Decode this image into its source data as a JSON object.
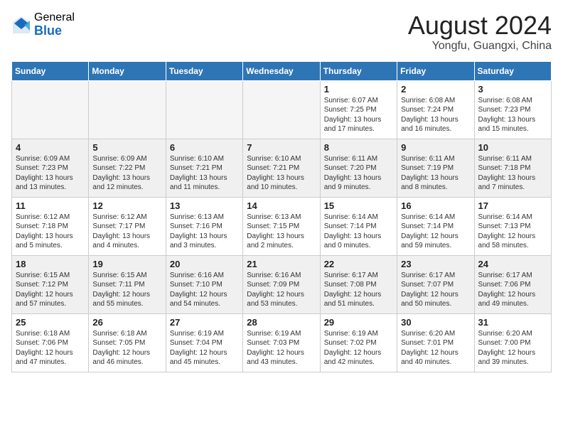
{
  "header": {
    "logo_general": "General",
    "logo_blue": "Blue",
    "month_year": "August 2024",
    "location": "Yongfu, Guangxi, China"
  },
  "weekdays": [
    "Sunday",
    "Monday",
    "Tuesday",
    "Wednesday",
    "Thursday",
    "Friday",
    "Saturday"
  ],
  "weeks": [
    [
      {
        "day": "",
        "info": ""
      },
      {
        "day": "",
        "info": ""
      },
      {
        "day": "",
        "info": ""
      },
      {
        "day": "",
        "info": ""
      },
      {
        "day": "1",
        "info": "Sunrise: 6:07 AM\nSunset: 7:25 PM\nDaylight: 13 hours\nand 17 minutes."
      },
      {
        "day": "2",
        "info": "Sunrise: 6:08 AM\nSunset: 7:24 PM\nDaylight: 13 hours\nand 16 minutes."
      },
      {
        "day": "3",
        "info": "Sunrise: 6:08 AM\nSunset: 7:23 PM\nDaylight: 13 hours\nand 15 minutes."
      }
    ],
    [
      {
        "day": "4",
        "info": "Sunrise: 6:09 AM\nSunset: 7:23 PM\nDaylight: 13 hours\nand 13 minutes."
      },
      {
        "day": "5",
        "info": "Sunrise: 6:09 AM\nSunset: 7:22 PM\nDaylight: 13 hours\nand 12 minutes."
      },
      {
        "day": "6",
        "info": "Sunrise: 6:10 AM\nSunset: 7:21 PM\nDaylight: 13 hours\nand 11 minutes."
      },
      {
        "day": "7",
        "info": "Sunrise: 6:10 AM\nSunset: 7:21 PM\nDaylight: 13 hours\nand 10 minutes."
      },
      {
        "day": "8",
        "info": "Sunrise: 6:11 AM\nSunset: 7:20 PM\nDaylight: 13 hours\nand 9 minutes."
      },
      {
        "day": "9",
        "info": "Sunrise: 6:11 AM\nSunset: 7:19 PM\nDaylight: 13 hours\nand 8 minutes."
      },
      {
        "day": "10",
        "info": "Sunrise: 6:11 AM\nSunset: 7:18 PM\nDaylight: 13 hours\nand 7 minutes."
      }
    ],
    [
      {
        "day": "11",
        "info": "Sunrise: 6:12 AM\nSunset: 7:18 PM\nDaylight: 13 hours\nand 5 minutes."
      },
      {
        "day": "12",
        "info": "Sunrise: 6:12 AM\nSunset: 7:17 PM\nDaylight: 13 hours\nand 4 minutes."
      },
      {
        "day": "13",
        "info": "Sunrise: 6:13 AM\nSunset: 7:16 PM\nDaylight: 13 hours\nand 3 minutes."
      },
      {
        "day": "14",
        "info": "Sunrise: 6:13 AM\nSunset: 7:15 PM\nDaylight: 13 hours\nand 2 minutes."
      },
      {
        "day": "15",
        "info": "Sunrise: 6:14 AM\nSunset: 7:14 PM\nDaylight: 13 hours\nand 0 minutes."
      },
      {
        "day": "16",
        "info": "Sunrise: 6:14 AM\nSunset: 7:14 PM\nDaylight: 12 hours\nand 59 minutes."
      },
      {
        "day": "17",
        "info": "Sunrise: 6:14 AM\nSunset: 7:13 PM\nDaylight: 12 hours\nand 58 minutes."
      }
    ],
    [
      {
        "day": "18",
        "info": "Sunrise: 6:15 AM\nSunset: 7:12 PM\nDaylight: 12 hours\nand 57 minutes."
      },
      {
        "day": "19",
        "info": "Sunrise: 6:15 AM\nSunset: 7:11 PM\nDaylight: 12 hours\nand 55 minutes."
      },
      {
        "day": "20",
        "info": "Sunrise: 6:16 AM\nSunset: 7:10 PM\nDaylight: 12 hours\nand 54 minutes."
      },
      {
        "day": "21",
        "info": "Sunrise: 6:16 AM\nSunset: 7:09 PM\nDaylight: 12 hours\nand 53 minutes."
      },
      {
        "day": "22",
        "info": "Sunrise: 6:17 AM\nSunset: 7:08 PM\nDaylight: 12 hours\nand 51 minutes."
      },
      {
        "day": "23",
        "info": "Sunrise: 6:17 AM\nSunset: 7:07 PM\nDaylight: 12 hours\nand 50 minutes."
      },
      {
        "day": "24",
        "info": "Sunrise: 6:17 AM\nSunset: 7:06 PM\nDaylight: 12 hours\nand 49 minutes."
      }
    ],
    [
      {
        "day": "25",
        "info": "Sunrise: 6:18 AM\nSunset: 7:06 PM\nDaylight: 12 hours\nand 47 minutes."
      },
      {
        "day": "26",
        "info": "Sunrise: 6:18 AM\nSunset: 7:05 PM\nDaylight: 12 hours\nand 46 minutes."
      },
      {
        "day": "27",
        "info": "Sunrise: 6:19 AM\nSunset: 7:04 PM\nDaylight: 12 hours\nand 45 minutes."
      },
      {
        "day": "28",
        "info": "Sunrise: 6:19 AM\nSunset: 7:03 PM\nDaylight: 12 hours\nand 43 minutes."
      },
      {
        "day": "29",
        "info": "Sunrise: 6:19 AM\nSunset: 7:02 PM\nDaylight: 12 hours\nand 42 minutes."
      },
      {
        "day": "30",
        "info": "Sunrise: 6:20 AM\nSunset: 7:01 PM\nDaylight: 12 hours\nand 40 minutes."
      },
      {
        "day": "31",
        "info": "Sunrise: 6:20 AM\nSunset: 7:00 PM\nDaylight: 12 hours\nand 39 minutes."
      }
    ]
  ]
}
